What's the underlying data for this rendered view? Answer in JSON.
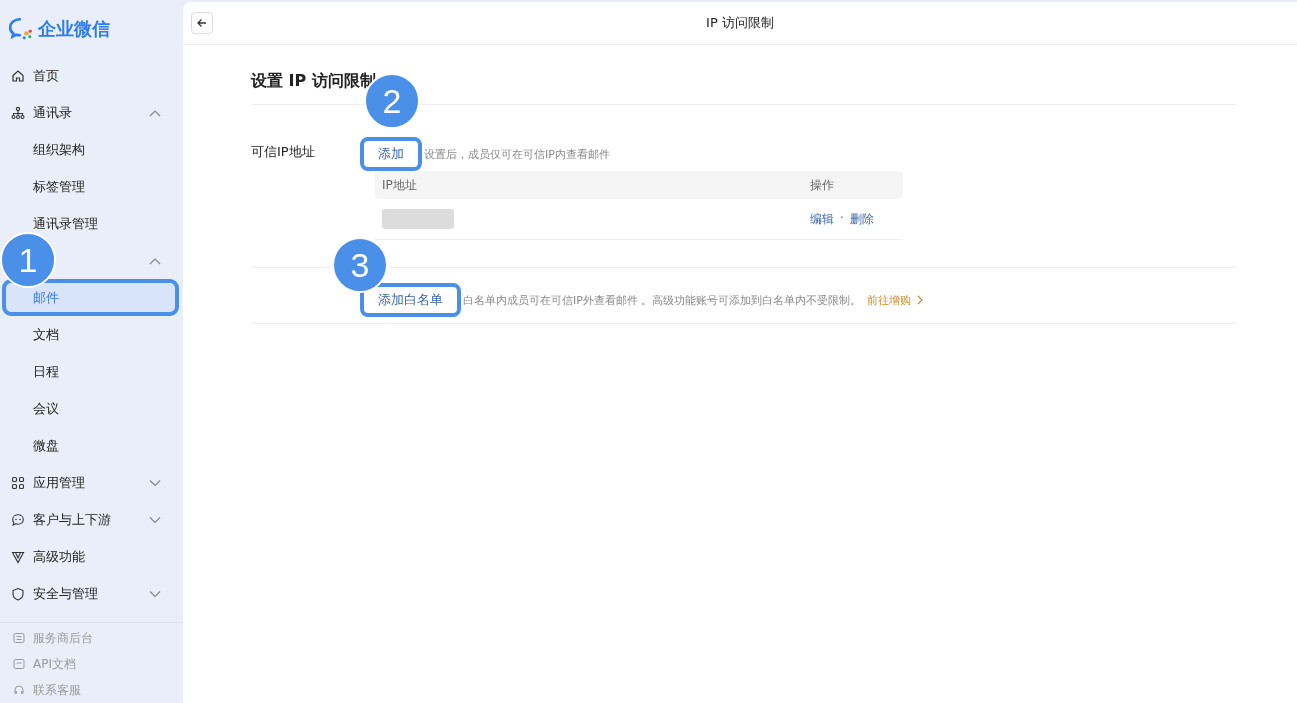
{
  "logo": {
    "text": "企业微信"
  },
  "sidebar": {
    "items": [
      {
        "kind": "item",
        "label": "首页"
      },
      {
        "kind": "group",
        "label": "通讯录",
        "expanded": true,
        "children": [
          {
            "label": "组织架构",
            "selected": false,
            "highlighted": false
          },
          {
            "label": "标签管理",
            "selected": false,
            "highlighted": false
          },
          {
            "label": "通讯录管理",
            "selected": false,
            "highlighted": false
          }
        ]
      },
      {
        "kind": "group",
        "callout": "1",
        "expanded": true,
        "children": [
          {
            "label": "邮件",
            "selected": true,
            "highlighted": true
          },
          {
            "label": "文档",
            "selected": false,
            "highlighted": false
          },
          {
            "label": "日程",
            "selected": false,
            "highlighted": false
          },
          {
            "label": "会议",
            "selected": false,
            "highlighted": false
          },
          {
            "label": "微盘",
            "selected": false,
            "highlighted": false
          }
        ]
      },
      {
        "kind": "group",
        "label": "应用管理",
        "expanded": false
      },
      {
        "kind": "group",
        "label": "客户与上下游",
        "expanded": false
      },
      {
        "kind": "item",
        "label": "高级功能"
      },
      {
        "kind": "group",
        "label": "安全与管理",
        "expanded": false
      }
    ],
    "footer": [
      "服务商后台",
      "API文档",
      "联系客服"
    ]
  },
  "header": {
    "title": "IP 访问限制"
  },
  "section": {
    "heading": "设置 IP 访问限制",
    "trusted": {
      "label": "可信IP地址",
      "action": {
        "text": "添加",
        "callout": "2",
        "highlighted": true
      },
      "hint": "设置后，成员仅可在可信IP内查看邮件",
      "table": {
        "columns": [
          "IP地址",
          "操作"
        ],
        "rows": [
          {
            "actions": [
              "编辑",
              "删除"
            ],
            "separator": "·"
          }
        ]
      }
    },
    "whitelist": {
      "action": {
        "text": "添加白名单",
        "callout": "3",
        "highlighted": true
      },
      "hint": "白名单内成员可在可信IP外查看邮件 。高级功能账号可添加到白名单内不受限制。",
      "link": "前往增购"
    }
  }
}
